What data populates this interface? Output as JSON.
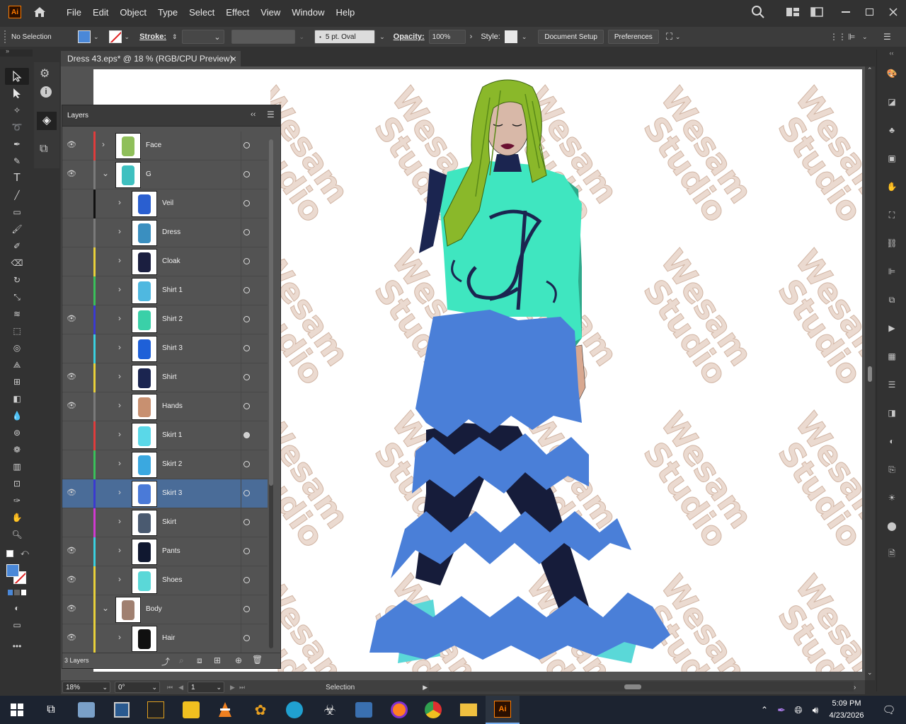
{
  "app": {
    "logo": "Ai",
    "menus": [
      "File",
      "Edit",
      "Object",
      "Type",
      "Select",
      "Effect",
      "View",
      "Window",
      "Help"
    ]
  },
  "control": {
    "selection": "No Selection",
    "stroke_label": "Stroke:",
    "brush": "5 pt. Oval",
    "opacity_label": "Opacity:",
    "opacity_value": "100%",
    "style_label": "Style:",
    "document_setup": "Document Setup",
    "preferences": "Preferences"
  },
  "document": {
    "tab_title": "Dress 43.eps* @ 18 % (RGB/CPU Preview)",
    "close": "×"
  },
  "layers": {
    "title": "Layers",
    "footer_count": "3 Layers",
    "rows": [
      {
        "name": "Face",
        "visible": true,
        "level": 0,
        "expanded": false,
        "color": "#e03c3c",
        "thumb_color": "#8fbf5a"
      },
      {
        "name": "G",
        "visible": true,
        "level": 0,
        "expanded": true,
        "color": "#7a7a7a",
        "thumb_color": "#3ec0c0"
      },
      {
        "name": "Veil",
        "visible": false,
        "level": 1,
        "expanded": false,
        "color": "#111111",
        "thumb_color": "#2a5fd0"
      },
      {
        "name": "Dress",
        "visible": false,
        "level": 1,
        "expanded": false,
        "color": "#7a7a7a",
        "thumb_color": "#3a8fc0"
      },
      {
        "name": "Cloak",
        "visible": false,
        "level": 1,
        "expanded": false,
        "color": "#e8d03a",
        "thumb_color": "#1b1f40"
      },
      {
        "name": "Shirt 1",
        "visible": false,
        "level": 1,
        "expanded": false,
        "color": "#3ac05a",
        "thumb_color": "#4fb8e0"
      },
      {
        "name": "Shirt 2",
        "visible": true,
        "level": 1,
        "expanded": false,
        "color": "#3a3ad0",
        "thumb_color": "#3ad0a8"
      },
      {
        "name": "Shirt 3",
        "visible": false,
        "level": 1,
        "expanded": false,
        "color": "#3ad0e0",
        "thumb_color": "#1e60d8"
      },
      {
        "name": "Shirt",
        "visible": true,
        "level": 1,
        "expanded": false,
        "color": "#e8d03a",
        "thumb_color": "#1b2550"
      },
      {
        "name": "Hands",
        "visible": true,
        "level": 1,
        "expanded": false,
        "color": "#7a7a7a",
        "thumb_color": "#c89070"
      },
      {
        "name": "Skirt 1",
        "visible": false,
        "level": 1,
        "expanded": false,
        "color": "#e03c3c",
        "thumb_color": "#5ad8e8"
      },
      {
        "name": "Skirt 2",
        "visible": false,
        "level": 1,
        "expanded": false,
        "color": "#3ac05a",
        "thumb_color": "#3aa8e0"
      },
      {
        "name": "Skirt 3",
        "visible": true,
        "level": 1,
        "expanded": false,
        "color": "#3a3ad0",
        "thumb_color": "#4a7ad8",
        "selected": true
      },
      {
        "name": "Skirt",
        "visible": false,
        "level": 1,
        "expanded": false,
        "color": "#d03ad0",
        "thumb_color": "#4a5a70"
      },
      {
        "name": "Pants",
        "visible": true,
        "level": 1,
        "expanded": false,
        "color": "#3ad0e0",
        "thumb_color": "#101830"
      },
      {
        "name": "Shoes",
        "visible": true,
        "level": 1,
        "expanded": false,
        "color": "#e8d03a",
        "thumb_color": "#5ad8d8"
      },
      {
        "name": "Body",
        "visible": true,
        "level": 0,
        "expanded": true,
        "color": "#e8d03a",
        "thumb_color": "#a08070"
      },
      {
        "name": "Hair",
        "visible": true,
        "level": 1,
        "expanded": false,
        "color": "#e8d03a",
        "thumb_color": "#101010"
      }
    ]
  },
  "status": {
    "zoom": "18%",
    "rotation": "0°",
    "artboard": "1",
    "mode": "Selection"
  },
  "watermark": "Wesam Studio",
  "taskbar": {
    "time": "5:09 PM",
    "date": "4/23/2026"
  },
  "colors": {
    "accent_selected": "#4a6c98",
    "fill": "#4a88d8",
    "skirt": "#4a7fd8",
    "shirt": "#3fe6c0",
    "hair": "#8ab82a",
    "pants": "#161c3a"
  }
}
